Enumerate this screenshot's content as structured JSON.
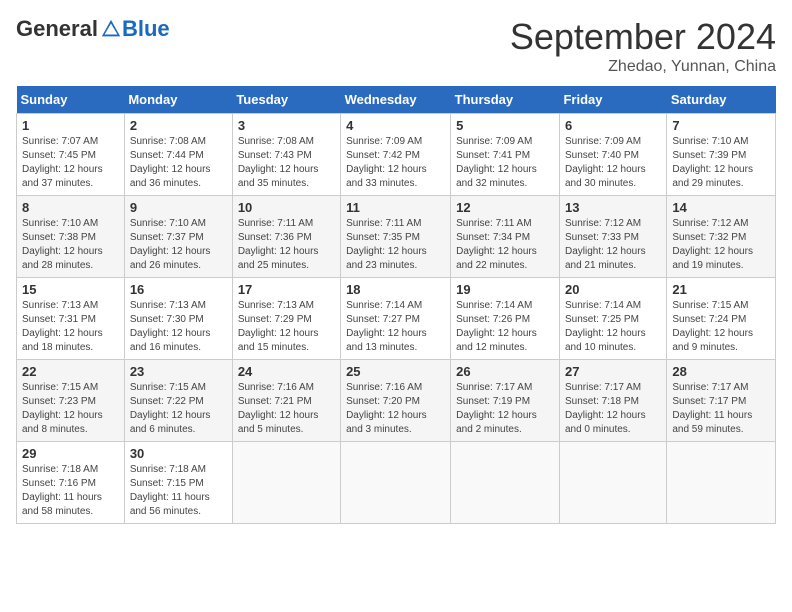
{
  "header": {
    "logo_general": "General",
    "logo_blue": "Blue",
    "month_title": "September 2024",
    "location": "Zhedao, Yunnan, China"
  },
  "weekdays": [
    "Sunday",
    "Monday",
    "Tuesday",
    "Wednesday",
    "Thursday",
    "Friday",
    "Saturday"
  ],
  "weeks": [
    [
      {
        "day": "1",
        "info": "Sunrise: 7:07 AM\nSunset: 7:45 PM\nDaylight: 12 hours and 37 minutes."
      },
      {
        "day": "2",
        "info": "Sunrise: 7:08 AM\nSunset: 7:44 PM\nDaylight: 12 hours and 36 minutes."
      },
      {
        "day": "3",
        "info": "Sunrise: 7:08 AM\nSunset: 7:43 PM\nDaylight: 12 hours and 35 minutes."
      },
      {
        "day": "4",
        "info": "Sunrise: 7:09 AM\nSunset: 7:42 PM\nDaylight: 12 hours and 33 minutes."
      },
      {
        "day": "5",
        "info": "Sunrise: 7:09 AM\nSunset: 7:41 PM\nDaylight: 12 hours and 32 minutes."
      },
      {
        "day": "6",
        "info": "Sunrise: 7:09 AM\nSunset: 7:40 PM\nDaylight: 12 hours and 30 minutes."
      },
      {
        "day": "7",
        "info": "Sunrise: 7:10 AM\nSunset: 7:39 PM\nDaylight: 12 hours and 29 minutes."
      }
    ],
    [
      {
        "day": "8",
        "info": "Sunrise: 7:10 AM\nSunset: 7:38 PM\nDaylight: 12 hours and 28 minutes."
      },
      {
        "day": "9",
        "info": "Sunrise: 7:10 AM\nSunset: 7:37 PM\nDaylight: 12 hours and 26 minutes."
      },
      {
        "day": "10",
        "info": "Sunrise: 7:11 AM\nSunset: 7:36 PM\nDaylight: 12 hours and 25 minutes."
      },
      {
        "day": "11",
        "info": "Sunrise: 7:11 AM\nSunset: 7:35 PM\nDaylight: 12 hours and 23 minutes."
      },
      {
        "day": "12",
        "info": "Sunrise: 7:11 AM\nSunset: 7:34 PM\nDaylight: 12 hours and 22 minutes."
      },
      {
        "day": "13",
        "info": "Sunrise: 7:12 AM\nSunset: 7:33 PM\nDaylight: 12 hours and 21 minutes."
      },
      {
        "day": "14",
        "info": "Sunrise: 7:12 AM\nSunset: 7:32 PM\nDaylight: 12 hours and 19 minutes."
      }
    ],
    [
      {
        "day": "15",
        "info": "Sunrise: 7:13 AM\nSunset: 7:31 PM\nDaylight: 12 hours and 18 minutes."
      },
      {
        "day": "16",
        "info": "Sunrise: 7:13 AM\nSunset: 7:30 PM\nDaylight: 12 hours and 16 minutes."
      },
      {
        "day": "17",
        "info": "Sunrise: 7:13 AM\nSunset: 7:29 PM\nDaylight: 12 hours and 15 minutes."
      },
      {
        "day": "18",
        "info": "Sunrise: 7:14 AM\nSunset: 7:27 PM\nDaylight: 12 hours and 13 minutes."
      },
      {
        "day": "19",
        "info": "Sunrise: 7:14 AM\nSunset: 7:26 PM\nDaylight: 12 hours and 12 minutes."
      },
      {
        "day": "20",
        "info": "Sunrise: 7:14 AM\nSunset: 7:25 PM\nDaylight: 12 hours and 10 minutes."
      },
      {
        "day": "21",
        "info": "Sunrise: 7:15 AM\nSunset: 7:24 PM\nDaylight: 12 hours and 9 minutes."
      }
    ],
    [
      {
        "day": "22",
        "info": "Sunrise: 7:15 AM\nSunset: 7:23 PM\nDaylight: 12 hours and 8 minutes."
      },
      {
        "day": "23",
        "info": "Sunrise: 7:15 AM\nSunset: 7:22 PM\nDaylight: 12 hours and 6 minutes."
      },
      {
        "day": "24",
        "info": "Sunrise: 7:16 AM\nSunset: 7:21 PM\nDaylight: 12 hours and 5 minutes."
      },
      {
        "day": "25",
        "info": "Sunrise: 7:16 AM\nSunset: 7:20 PM\nDaylight: 12 hours and 3 minutes."
      },
      {
        "day": "26",
        "info": "Sunrise: 7:17 AM\nSunset: 7:19 PM\nDaylight: 12 hours and 2 minutes."
      },
      {
        "day": "27",
        "info": "Sunrise: 7:17 AM\nSunset: 7:18 PM\nDaylight: 12 hours and 0 minutes."
      },
      {
        "day": "28",
        "info": "Sunrise: 7:17 AM\nSunset: 7:17 PM\nDaylight: 11 hours and 59 minutes."
      }
    ],
    [
      {
        "day": "29",
        "info": "Sunrise: 7:18 AM\nSunset: 7:16 PM\nDaylight: 11 hours and 58 minutes."
      },
      {
        "day": "30",
        "info": "Sunrise: 7:18 AM\nSunset: 7:15 PM\nDaylight: 11 hours and 56 minutes."
      },
      null,
      null,
      null,
      null,
      null
    ]
  ]
}
